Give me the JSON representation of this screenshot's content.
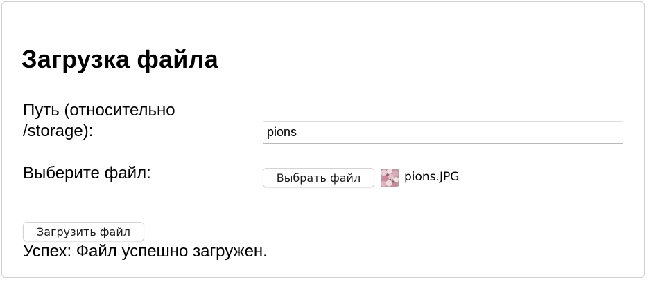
{
  "form": {
    "title": "Загрузка файла",
    "path_label": "Путь (относительно /storage):",
    "path_value": "pions",
    "file_label": "Выберите файл:",
    "choose_button_label": "Выбрать файл",
    "selected_file_name": "pions.JPG",
    "selected_file_icon": "image-thumbnail-icon",
    "upload_button_label": "Загрузить файл",
    "status_message": "Успех: Файл успешно загружен."
  }
}
